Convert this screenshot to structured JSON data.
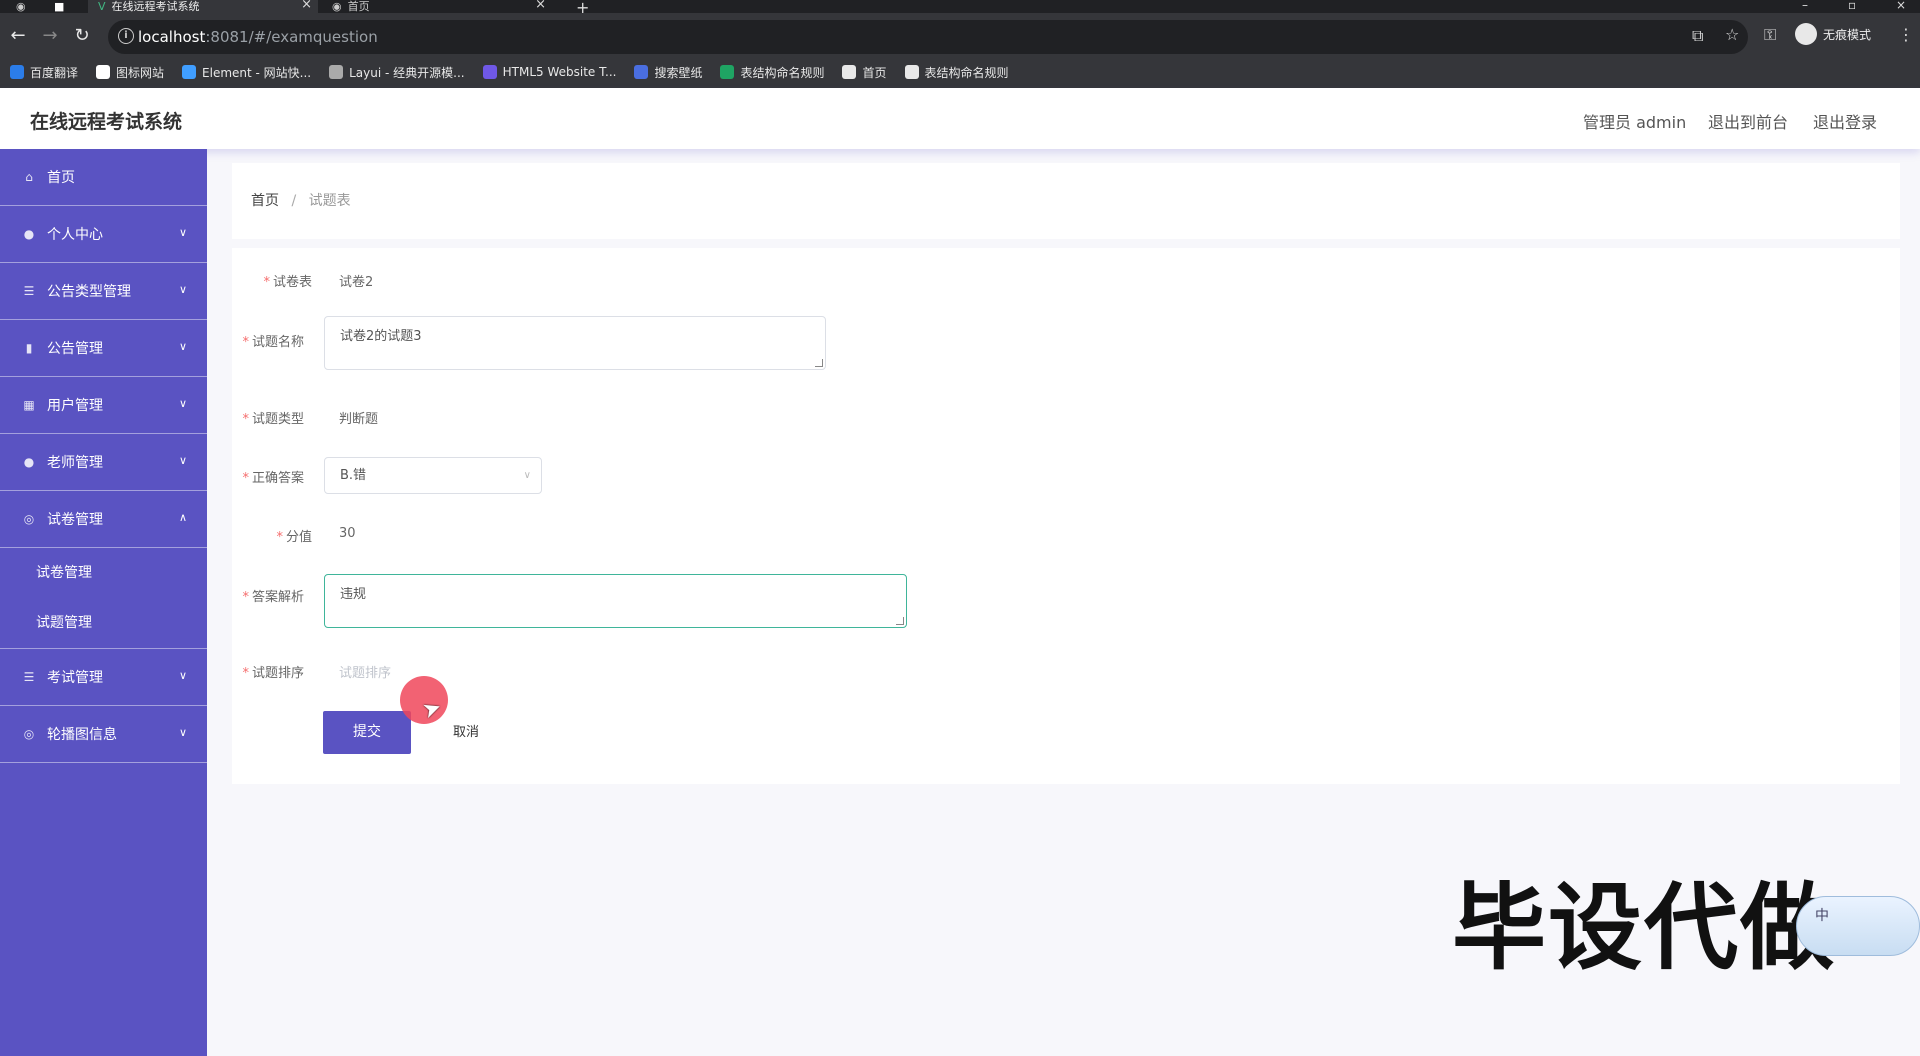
{
  "browser": {
    "tabs": [
      {
        "title": "在线远程考试系统",
        "active": true
      },
      {
        "title": "首页",
        "active": false
      }
    ],
    "url_host": "localhost",
    "url_rest": ":8081/#/examquestion",
    "incognito_label": "无痕模式",
    "bookmarks": [
      {
        "label": "百度翻译",
        "color": "#2b7de9"
      },
      {
        "label": "图标网站",
        "color": "#ffffff"
      },
      {
        "label": "Element - 网站快...",
        "color": "#409eff"
      },
      {
        "label": "Layui - 经典开源模...",
        "color": "#aaaaaa"
      },
      {
        "label": "HTML5 Website T...",
        "color": "#6f58e6"
      },
      {
        "label": "搜索壁纸",
        "color": "#4a6ee0"
      },
      {
        "label": "表结构命名规则",
        "color": "#1fa463"
      },
      {
        "label": "首页",
        "color": "#e8e8e8"
      },
      {
        "label": "表结构命名规则",
        "color": "#e8e8e8"
      }
    ]
  },
  "header": {
    "title": "在线远程考试系统",
    "admin_label": "管理员 admin",
    "to_front_label": "退出到前台",
    "logout_label": "退出登录"
  },
  "sidebar": {
    "items": [
      {
        "label": "首页",
        "icon": "home-icon",
        "glyph": "⌂",
        "has_arrow": false
      },
      {
        "label": "个人中心",
        "icon": "user-icon",
        "glyph": "●",
        "has_arrow": true
      },
      {
        "label": "公告类型管理",
        "icon": "list-icon",
        "glyph": "☰",
        "has_arrow": true
      },
      {
        "label": "公告管理",
        "icon": "bar-chart-icon",
        "glyph": "▮",
        "has_arrow": true
      },
      {
        "label": "用户管理",
        "icon": "grid-icon",
        "glyph": "▦",
        "has_arrow": true
      },
      {
        "label": "老师管理",
        "icon": "user-icon",
        "glyph": "●",
        "has_arrow": true
      },
      {
        "label": "试卷管理",
        "icon": "circle-icon",
        "glyph": "◎",
        "has_arrow": true,
        "expanded": true
      },
      {
        "label": "考试管理",
        "icon": "list-icon",
        "glyph": "☰",
        "has_arrow": true
      },
      {
        "label": "轮播图信息",
        "icon": "circle-icon",
        "glyph": "◎",
        "has_arrow": true
      }
    ],
    "submenu": [
      "试卷管理",
      "试题管理"
    ]
  },
  "breadcrumb": {
    "home": "首页",
    "separator": "/",
    "current": "试题表"
  },
  "form": {
    "paper": {
      "label": "试卷表",
      "value": "试卷2"
    },
    "question_name": {
      "label": "试题名称",
      "value": "试卷2的试题3"
    },
    "question_type": {
      "label": "试题类型",
      "value": "判断题"
    },
    "answer": {
      "label": "正确答案",
      "value": "B.错"
    },
    "score": {
      "label": "分值",
      "value": "30"
    },
    "analysis": {
      "label": "答案解析",
      "value": "违规"
    },
    "order": {
      "label": "试题排序",
      "placeholder": "试题排序"
    },
    "submit_label": "提交",
    "cancel_label": "取消"
  },
  "overlay": {
    "watermark": "毕设代做",
    "ime_text": "中"
  },
  "colors": {
    "primary": "#5a53c2",
    "required": "#f56c6c",
    "focus_border": "#3fb59a"
  }
}
